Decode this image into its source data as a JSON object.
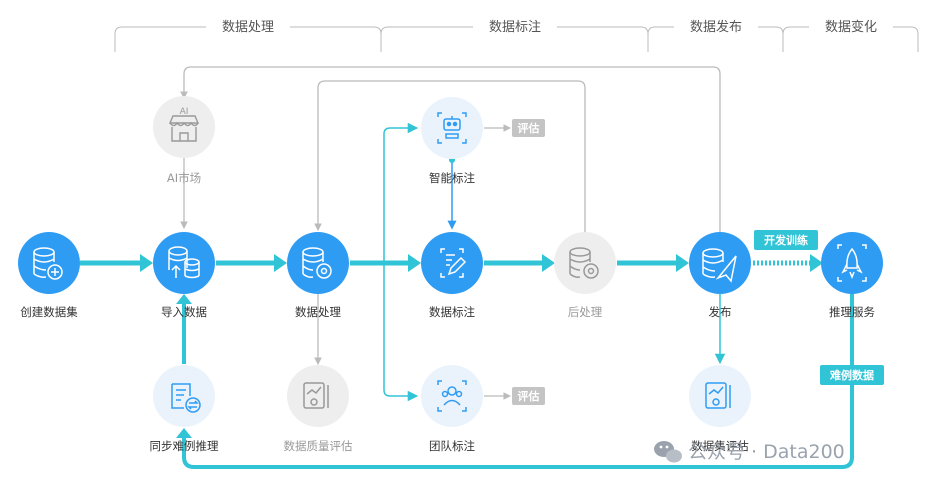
{
  "stages": [
    "数据处理",
    "数据标注",
    "数据发布",
    "数据变化"
  ],
  "nodes": {
    "create_dataset": "创建数据集",
    "import_data": "导入数据",
    "data_processing": "数据处理",
    "data_annotation": "数据标注",
    "post_processing": "后处理",
    "publish": "发布",
    "inference_service": "推理服务",
    "ai_market": "AI市场",
    "smart_annotation": "智能标注",
    "team_annotation": "团队标注",
    "sync_hard_cases": "同步难例推理",
    "data_quality_eval": "数据质量评估",
    "dataset_eval": "数据集评估"
  },
  "tags": {
    "eval_smart": "评估",
    "eval_team": "评估",
    "dev_training": "开发训练",
    "hard_case_data": "难例数据"
  },
  "watermark": "公众号 · Data200",
  "colors": {
    "primary": "#2f9cf4",
    "flow": "#31c4d6",
    "light_circle": "#eaf3fb",
    "gray_circle": "#eeeeee",
    "connector": "#bbbbbb"
  }
}
